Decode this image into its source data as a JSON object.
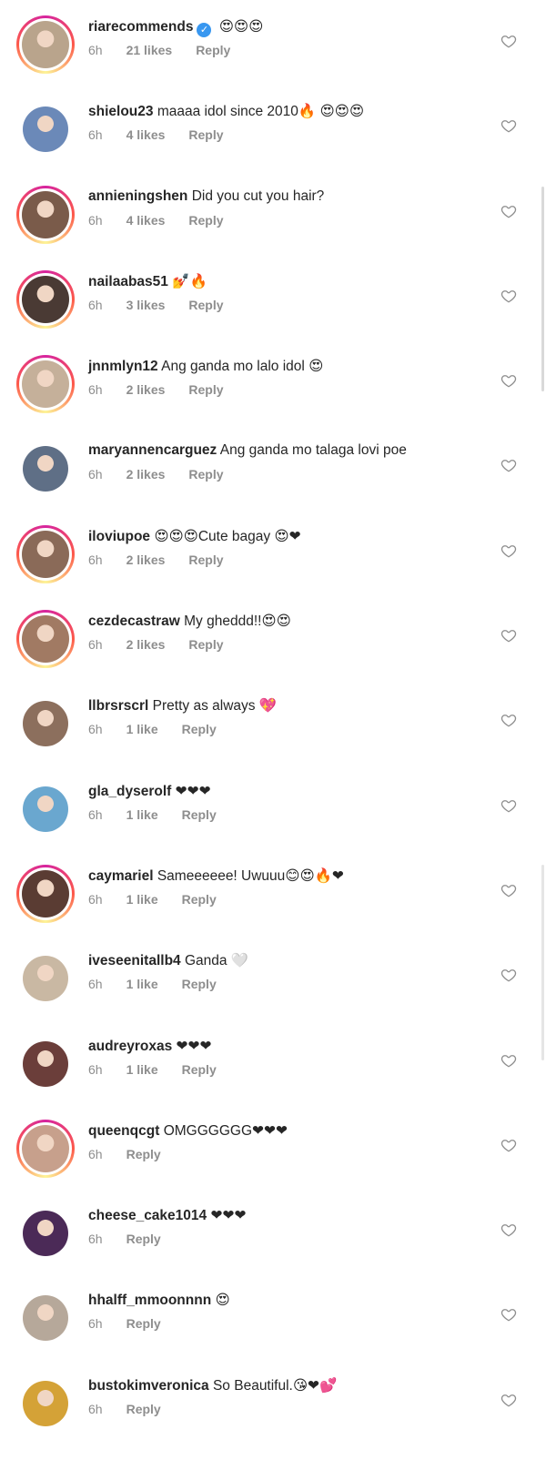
{
  "comments": [
    {
      "username": "riarecommends",
      "verified": true,
      "text": "😍😍😍",
      "time": "6h",
      "likes": "21 likes",
      "reply": "Reply",
      "ring": true,
      "avatar_color": "#b9a48c"
    },
    {
      "username": "shielou23",
      "verified": false,
      "text": "maaaa idol since 2010🔥 😍😍😍",
      "time": "6h",
      "likes": "4 likes",
      "reply": "Reply",
      "ring": false,
      "avatar_color": "#6b89b8"
    },
    {
      "username": "annieningshen",
      "verified": false,
      "text": "Did you cut you hair?",
      "time": "6h",
      "likes": "4 likes",
      "reply": "Reply",
      "ring": true,
      "avatar_color": "#7a5b4a"
    },
    {
      "username": "nailaabas51",
      "verified": false,
      "text": "💅🔥",
      "time": "6h",
      "likes": "3 likes",
      "reply": "Reply",
      "ring": true,
      "avatar_color": "#4a3a34"
    },
    {
      "username": "jnnmlyn12",
      "verified": false,
      "text": "Ang ganda mo lalo idol 😍",
      "time": "6h",
      "likes": "2 likes",
      "reply": "Reply",
      "ring": true,
      "avatar_color": "#c5b09a"
    },
    {
      "username": "maryannencarguez",
      "verified": false,
      "text": "Ang ganda mo talaga lovi poe",
      "time": "6h",
      "likes": "2 likes",
      "reply": "Reply",
      "ring": false,
      "avatar_color": "#5f6f86"
    },
    {
      "username": "iloviupoe",
      "verified": false,
      "text": "😍😍😍Cute bagay 😍❤",
      "time": "6h",
      "likes": "2 likes",
      "reply": "Reply",
      "ring": true,
      "avatar_color": "#8a6a58"
    },
    {
      "username": "cezdecastraw",
      "verified": false,
      "text": "My gheddd!!😍😍",
      "time": "6h",
      "likes": "2 likes",
      "reply": "Reply",
      "ring": true,
      "avatar_color": "#a17a63"
    },
    {
      "username": "llbrsrscrl",
      "verified": false,
      "text": "Pretty as always 💖",
      "time": "6h",
      "likes": "1 like",
      "reply": "Reply",
      "ring": false,
      "avatar_color": "#8c6f5d"
    },
    {
      "username": "gla_dyserolf",
      "verified": false,
      "text": "❤❤❤",
      "time": "6h",
      "likes": "1 like",
      "reply": "Reply",
      "ring": false,
      "avatar_color": "#6aa7cf"
    },
    {
      "username": "caymariel",
      "verified": false,
      "text": "Sameeeeee! Uwuuu😊😍🔥❤",
      "time": "6h",
      "likes": "1 like",
      "reply": "Reply",
      "ring": true,
      "avatar_color": "#5a3c33"
    },
    {
      "username": "iveseenitallb4",
      "verified": false,
      "text": "Ganda 🤍",
      "time": "6h",
      "likes": "1 like",
      "reply": "Reply",
      "ring": false,
      "avatar_color": "#c9b8a3"
    },
    {
      "username": "audreyroxas",
      "verified": false,
      "text": "❤❤❤",
      "time": "6h",
      "likes": "1 like",
      "reply": "Reply",
      "ring": false,
      "avatar_color": "#6b3e3a"
    },
    {
      "username": "queenqcgt",
      "verified": false,
      "text": "OMGGGGGG❤❤❤",
      "time": "6h",
      "likes": "",
      "reply": "Reply",
      "ring": true,
      "avatar_color": "#c7a08c"
    },
    {
      "username": "cheese_cake1014",
      "verified": false,
      "text": "❤❤❤",
      "time": "6h",
      "likes": "",
      "reply": "Reply",
      "ring": false,
      "avatar_color": "#4b2a57"
    },
    {
      "username": "hhalff_mmoonnnn",
      "verified": false,
      "text": "😍",
      "time": "6h",
      "likes": "",
      "reply": "Reply",
      "ring": false,
      "avatar_color": "#b6a89a"
    },
    {
      "username": "bustokimveronica",
      "verified": false,
      "text": "So Beautiful.😘❤💕",
      "time": "6h",
      "likes": "",
      "reply": "Reply",
      "ring": false,
      "avatar_color": "#d4a237"
    }
  ]
}
